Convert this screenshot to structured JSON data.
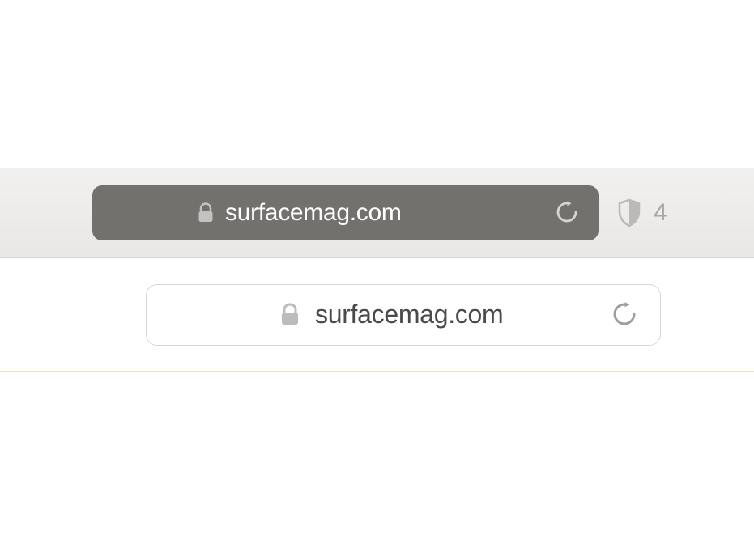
{
  "toolbar": {
    "address_bar_dark": {
      "url": "surfacemag.com"
    },
    "privacy": {
      "tracker_count": "4"
    }
  },
  "content": {
    "address_bar_light": {
      "url": "surfacemag.com"
    }
  }
}
